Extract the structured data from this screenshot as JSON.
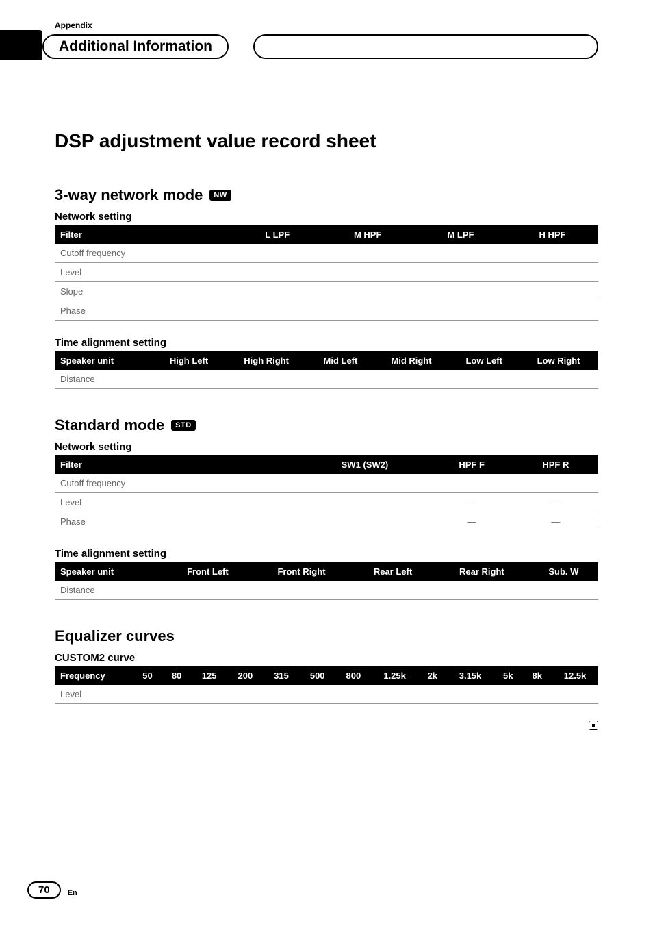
{
  "header": {
    "appendix": "Appendix",
    "section_title": "Additional Information"
  },
  "main_title": "DSP adjustment value record sheet",
  "mode3way": {
    "title": "3-way network mode",
    "badge": "NW",
    "network_setting_label": "Network setting",
    "filter_header": "Filter",
    "filter_cols": [
      "L LPF",
      "M HPF",
      "M LPF",
      "H HPF"
    ],
    "filter_rows": [
      "Cutoff frequency",
      "Level",
      "Slope",
      "Phase"
    ],
    "time_alignment_label": "Time alignment setting",
    "speaker_header": "Speaker unit",
    "speaker_cols": [
      "High Left",
      "High Right",
      "Mid Left",
      "Mid Right",
      "Low Left",
      "Low Right"
    ],
    "speaker_rows": [
      "Distance"
    ]
  },
  "standard": {
    "title": "Standard mode",
    "badge": "STD",
    "network_setting_label": "Network setting",
    "filter_header": "Filter",
    "filter_cols": [
      "SW1 (SW2)",
      "HPF F",
      "HPF R"
    ],
    "filter_rows": [
      {
        "label": "Cutoff frequency",
        "cells": [
          "",
          "",
          ""
        ]
      },
      {
        "label": "Level",
        "cells": [
          "",
          "—",
          "—"
        ]
      },
      {
        "label": "Phase",
        "cells": [
          "",
          "—",
          "—"
        ]
      }
    ],
    "time_alignment_label": "Time alignment setting",
    "speaker_header": "Speaker unit",
    "speaker_cols": [
      "Front Left",
      "Front Right",
      "Rear Left",
      "Rear Right",
      "Sub. W"
    ],
    "speaker_rows": [
      "Distance"
    ]
  },
  "equalizer": {
    "title": "Equalizer curves",
    "curve_label": "CUSTOM2 curve",
    "freq_header": "Frequency",
    "freq_cols": [
      "50",
      "80",
      "125",
      "200",
      "315",
      "500",
      "800",
      "1.25k",
      "2k",
      "3.15k",
      "5k",
      "8k",
      "12.5k"
    ],
    "freq_rows": [
      "Level"
    ]
  },
  "footer": {
    "page": "70",
    "lang": "En"
  }
}
